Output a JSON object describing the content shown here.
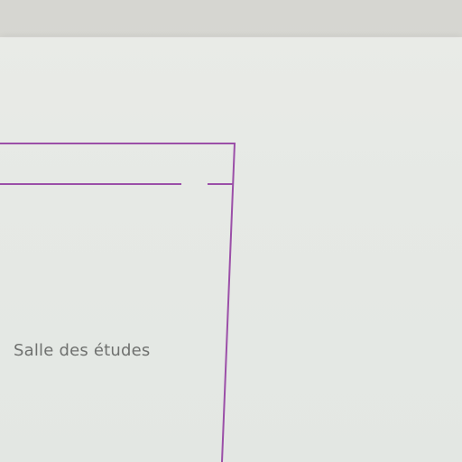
{
  "floor_plan": {
    "room_label": "Salle des études",
    "line_color": "#9b4fa8",
    "paper_color": "#e7eae6",
    "text_color": "#6f716f"
  }
}
